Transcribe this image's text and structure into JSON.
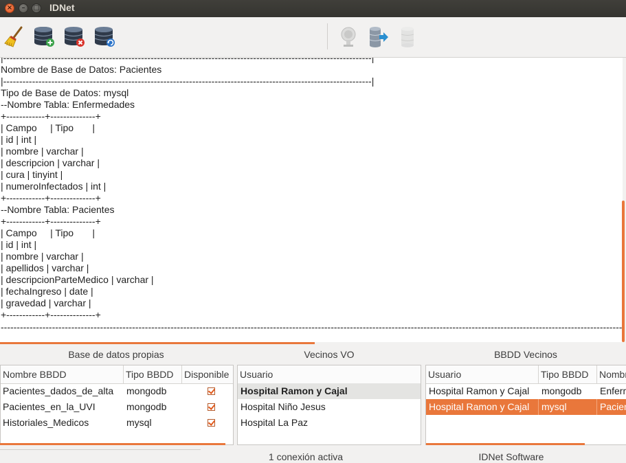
{
  "window": {
    "title": "IDNet",
    "close_glyph": "×",
    "min_glyph": "–",
    "max_glyph": "□"
  },
  "toolbar": {
    "icons": [
      "broom-icon",
      "database-add-icon",
      "database-remove-icon",
      "database-refresh-icon",
      "network-connect-icon",
      "database-export-icon",
      "database-disabled-icon"
    ]
  },
  "console": {
    "lines": [
      "|-------------------------------------------------------------------------------------------------------------------|",
      "Nombre de Base de Datos: Pacientes",
      "|-------------------------------------------------------------------------------------------------------------------|",
      "Tipo de Base de Datos: mysql",
      "--Nombre Tabla: Enfermedades",
      "+------------+--------------+",
      "| Campo     | Tipo       |",
      "| id | int |",
      "| nombre | varchar |",
      "| descripcion | varchar |",
      "| cura | tinyint |",
      "| numeroInfectados | int |",
      "+------------+--------------+",
      "--Nombre Tabla: Pacientes",
      "+------------+--------------+",
      "| Campo     | Tipo       |",
      "| id | int |",
      "| nombre | varchar |",
      "| apellidos | varchar |",
      "| descripcionParteMedico | varchar |",
      "| fechaIngreso | date |",
      "| gravedad | varchar |",
      "+------------+--------------+",
      "",
      "------------------------------------------------------------------------------------------------------------------------------------------------------------------------------------------------------------------"
    ]
  },
  "panels": {
    "own": {
      "title": "Base de datos propias",
      "headers": [
        "Nombre BBDD",
        "Tipo BBDD",
        "Disponible"
      ],
      "rows": [
        {
          "name": "Pacientes_dados_de_alta",
          "type": "mongodb",
          "available": true
        },
        {
          "name": "Pacientes_en_la_UVI",
          "type": "mongodb",
          "available": true
        },
        {
          "name": "Historiales_Medicos",
          "type": "mysql",
          "available": true
        }
      ]
    },
    "neighbors": {
      "title": "Vecinos VO",
      "headers": [
        "Usuario"
      ],
      "rows": [
        "Hospital Ramon y Cajal",
        "Hospital Niño Jesus",
        "Hospital La Paz"
      ],
      "selected_index": 0
    },
    "neighbor_dbs": {
      "title": "BBDD Vecinos",
      "headers": [
        "Usuario",
        "Tipo BBDD",
        "Nombre"
      ],
      "rows": [
        {
          "user": "Hospital Ramon y Cajal",
          "type": "mongodb",
          "name": "Enfermedades"
        },
        {
          "user": "Hospital Ramon y Cajal",
          "type": "mysql",
          "name": "Pacientes"
        }
      ],
      "selected_index": 1
    }
  },
  "status": {
    "connections": "1 conexión activa",
    "brand": "IDNet Software"
  },
  "colors": {
    "accent": "#e9773b",
    "selection": "#e9773b",
    "neighbor_selected": "#e4e4e2"
  }
}
